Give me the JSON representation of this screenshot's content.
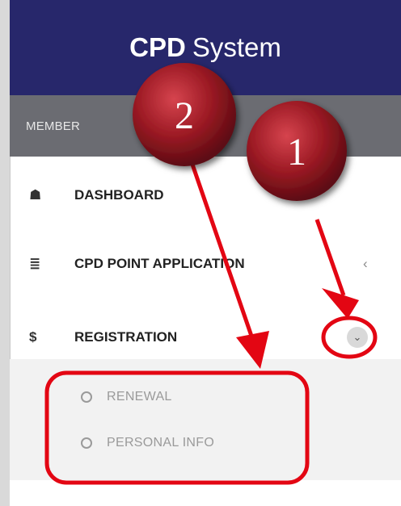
{
  "header": {
    "brand_strong": "CPD",
    "brand_rest": "System"
  },
  "sidebar": {
    "section_label": "MEMBER",
    "items": [
      {
        "label": "DASHBOARD",
        "icon": "home-icon",
        "glyph": "☗"
      },
      {
        "label": "CPD POINT APPLICATION",
        "icon": "list-icon",
        "glyph": "≣",
        "toggle": "‹"
      },
      {
        "label": "REGISTRATION",
        "icon": "dollar-icon",
        "glyph": "$",
        "toggle": "⌄"
      }
    ],
    "submenu": [
      {
        "label": "RENEWAL"
      },
      {
        "label": "PERSONAL INFO"
      }
    ]
  },
  "annotations": {
    "badge_1": "1",
    "badge_2": "2",
    "color": "#e30613"
  },
  "colors": {
    "header_bg": "#27276b",
    "section_bg": "#6b6c72",
    "submenu_bg": "#f2f2f2"
  }
}
